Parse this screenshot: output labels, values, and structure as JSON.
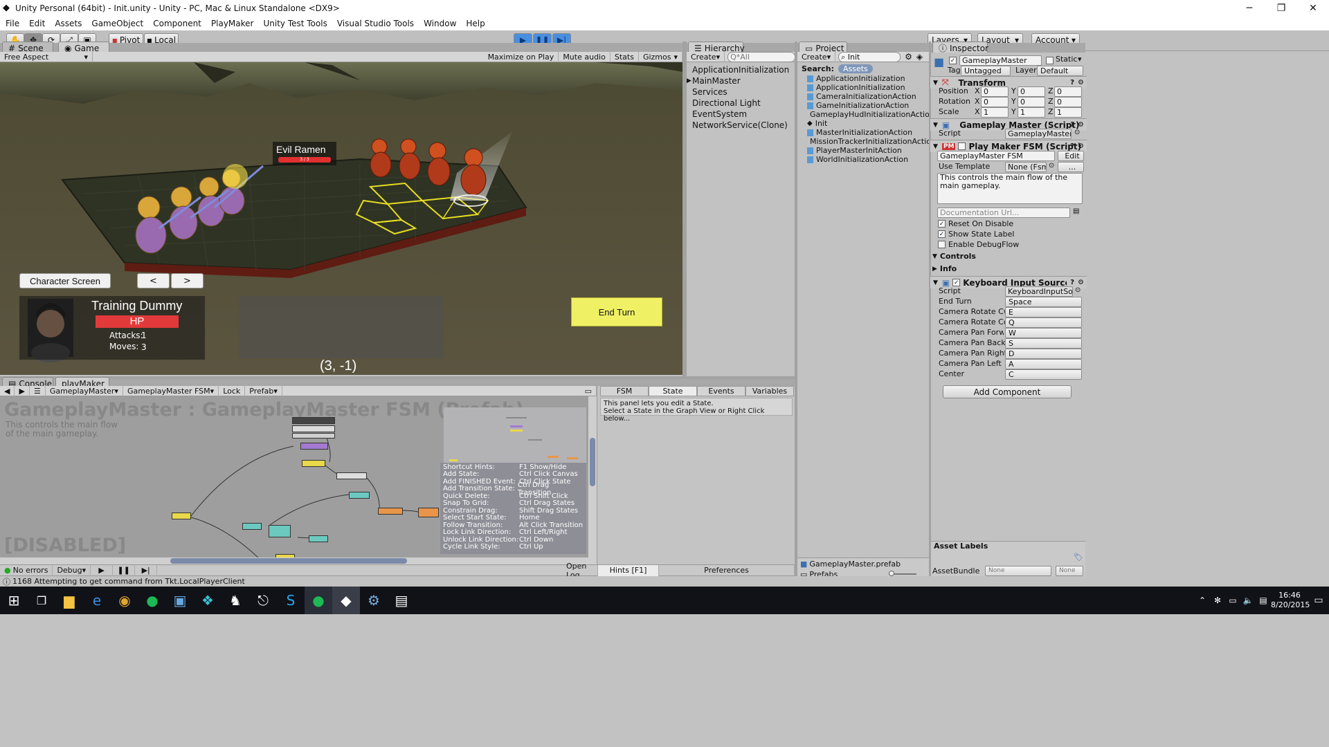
{
  "window": {
    "title": "Unity Personal (64bit) - Init.unity - Unity - PC, Mac & Linux Standalone <DX9>"
  },
  "menu": [
    "File",
    "Edit",
    "Assets",
    "GameObject",
    "Component",
    "PlayMaker",
    "Unity Test Tools",
    "Visual Studio Tools",
    "Window",
    "Help"
  ],
  "toolbar": {
    "pivot": "Pivot",
    "local": "Local",
    "layers": "Layers",
    "layout": "Layout",
    "account": "Account"
  },
  "scene_tabs": {
    "scene": "Scene",
    "game": "Game"
  },
  "game_bar": {
    "aspect": "Free Aspect",
    "maximize": "Maximize on Play",
    "mute": "Mute audio",
    "stats": "Stats",
    "gizmos": "Gizmos"
  },
  "game": {
    "enemy_name": "Evil Ramen",
    "enemy_hp": "3 / 3",
    "character_screen": "Character Screen",
    "prev": "<",
    "next": ">",
    "unit_name": "Training Dummy",
    "hp": "HP",
    "attacks_label": "Attacks:",
    "attacks_value": "1",
    "moves_label": "Moves:",
    "moves_value": "3",
    "end_turn": "End Turn",
    "coords": "(3, -1)"
  },
  "hierarchy": {
    "tab": "Hierarchy",
    "create": "Create",
    "search": "Q*All",
    "items": [
      "ApplicationInitialization",
      "MainMaster",
      "Services",
      "Directional Light",
      "EventSystem",
      "NetworkService(Clone)"
    ]
  },
  "project": {
    "tab": "Project",
    "create": "Create",
    "search_value": "Init",
    "search_label": "Search:",
    "assets_chip": "Assets",
    "items": [
      "ApplicationInitialization",
      "ApplicationInitialization",
      "CameraInitializationAction",
      "GameInitializationAction",
      "GameplayHudInitializationAction",
      "Init",
      "MasterInitializationAction",
      "MissionTrackerInitializationAction",
      "PlayerMasterInitAction",
      "WorldInitializationAction"
    ],
    "footer_file": "GameplayMaster.prefab",
    "footer_folder": "Prefabs"
  },
  "inspector": {
    "tab": "Inspector",
    "object_name": "GameplayMaster",
    "static": "Static",
    "tag_label": "Tag",
    "tag_value": "Untagged",
    "layer_label": "Layer",
    "layer_value": "Default",
    "transform": {
      "title": "Transform",
      "position": "Position",
      "rotation": "Rotation",
      "scale": "Scale",
      "pos": [
        "0",
        "0",
        "0"
      ],
      "rot": [
        "0",
        "0",
        "0"
      ],
      "scl": [
        "1",
        "1",
        "1"
      ],
      "x": "X",
      "y": "Y",
      "z": "Z"
    },
    "gameplay_master": {
      "title": "Gameplay Master (Script)",
      "script_label": "Script",
      "script_value": "GameplayMaster"
    },
    "fsm": {
      "title": "Play Maker FSM (Script)",
      "name": "GameplayMaster FSM",
      "edit": "Edit",
      "use_template": "Use Template",
      "template_value": "None (FsmT",
      "ellipsis": "...",
      "description": "This controls the main flow of the main gameplay.",
      "doc_url": "Documentation Url...",
      "reset": "Reset On Disable",
      "show_label": "Show State Label",
      "debug_flow": "Enable DebugFlow",
      "controls": "Controls",
      "info": "Info"
    },
    "keyboard": {
      "title": "Keyboard Input Source (Script)",
      "rows": [
        {
          "label": "Script",
          "value": "KeyboardInputSou"
        },
        {
          "label": "End Turn",
          "value": "Space"
        },
        {
          "label": "Camera Rotate Cw",
          "value": "E"
        },
        {
          "label": "Camera Rotate Ccw",
          "value": "Q"
        },
        {
          "label": "Camera Pan Forward",
          "value": "W"
        },
        {
          "label": "Camera Pan Back",
          "value": "S"
        },
        {
          "label": "Camera Pan Right",
          "value": "D"
        },
        {
          "label": "Camera Pan Left",
          "value": "A"
        },
        {
          "label": "Center",
          "value": "C"
        }
      ]
    },
    "add_component": "Add Component",
    "asset_labels": "Asset Labels",
    "asset_bundle": "AssetBundle",
    "none1": "None",
    "none2": "None"
  },
  "bottom_tabs": {
    "console": "Console",
    "playmaker": "playMaker"
  },
  "playmaker": {
    "obj": "GameplayMaster",
    "fsm": "GameplayMaster FSM",
    "lock": "Lock",
    "prefab": "Prefab",
    "heading": "GameplayMaster : GameplayMaster FSM (Prefab)",
    "desc1": "This controls the main flow",
    "desc2": "of the main gameplay.",
    "disabled": "[DISABLED]",
    "hints": [
      [
        "Shortcut Hints:",
        "F1 Show/Hide"
      ],
      [
        "Add State:",
        "Ctrl Click Canvas"
      ],
      [
        "Add FINISHED Event:",
        "Ctrl Click State"
      ],
      [
        "Add Transition State:",
        "Ctrl Drag Transition"
      ],
      [
        "Quick Delete:",
        "Ctrl Shift Click"
      ],
      [
        "Snap To Grid:",
        "Ctrl Drag States"
      ],
      [
        "Constrain Drag:",
        "Shift Drag States"
      ],
      [
        "Select Start State:",
        "Home"
      ],
      [
        "Follow Transition:",
        "Alt Click Transition"
      ],
      [
        "Lock Link Direction:",
        "Ctrl Left/Right"
      ],
      [
        "Unlock Link Direction:",
        "Ctrl Down"
      ],
      [
        "Cycle Link Style:",
        "Ctrl Up"
      ]
    ],
    "tabs": [
      "FSM",
      "State",
      "Events",
      "Variables"
    ],
    "state_msg1": "This panel lets you edit a State.",
    "state_msg2": "Select a State in the Graph View or Right Click below...",
    "no_errors": "No errors",
    "debug": "Debug",
    "open_log": "Open Log",
    "hints_btn": "Hints [F1]",
    "preferences": "Preferences"
  },
  "status": {
    "message": "1168 Attempting to get command from Tkt.LocalPlayerClient"
  },
  "clock": {
    "time": "16:46",
    "date": "8/20/2015"
  }
}
